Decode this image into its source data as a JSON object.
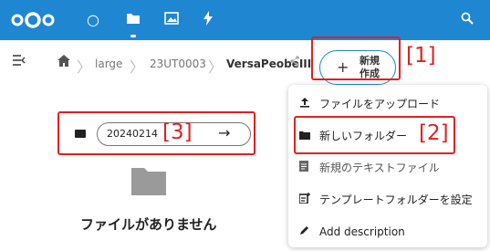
{
  "topbar": {
    "icons": [
      "nextcloud-logo",
      "circle-icon",
      "folder-icon",
      "image-icon",
      "lightning-icon",
      "search-icon"
    ]
  },
  "breadcrumb": {
    "items": [
      "large",
      "23UT0003",
      "VersaPeobeIII"
    ]
  },
  "new_button": {
    "plus": "+",
    "label_line1": "新規",
    "label_line2": "作成"
  },
  "annotations": {
    "n1": "[1]",
    "n2": "[2]",
    "n3": "[3]"
  },
  "menu": {
    "items": [
      {
        "icon": "upload-icon",
        "label": "ファイルをアップロード"
      },
      {
        "icon": "folder-icon",
        "label": "新しいフォルダー"
      },
      {
        "icon": "text-file-icon",
        "label": "新規のテキストファイル"
      },
      {
        "icon": "template-icon",
        "label": "テンプレートフォルダーを設定"
      },
      {
        "icon": "pencil-icon",
        "label": "Add description"
      }
    ]
  },
  "new_folder": {
    "value": "20240214",
    "arrow": "→"
  },
  "empty_state": {
    "text": "ファイルがありません"
  },
  "colors": {
    "header": "#1f86d1",
    "highlight": "#e02020"
  }
}
